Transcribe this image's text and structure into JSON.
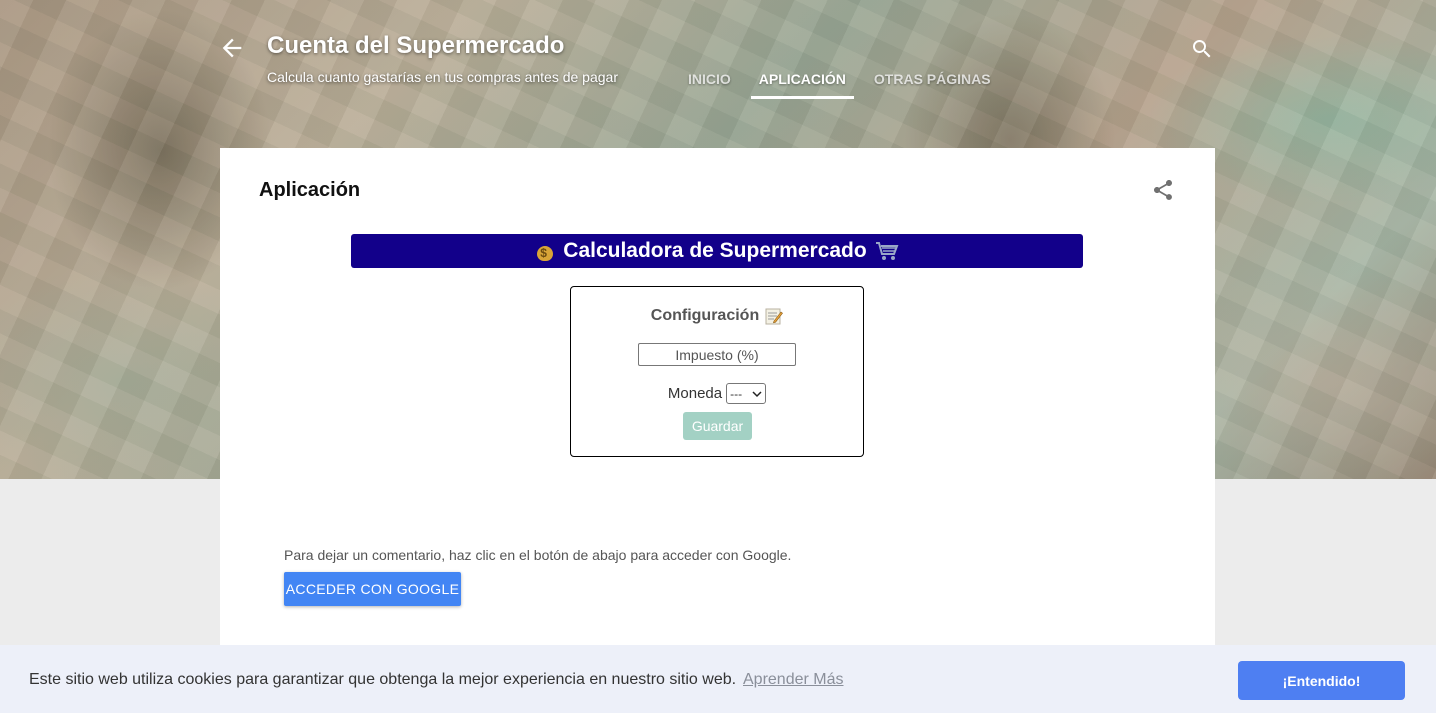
{
  "header": {
    "title": "Cuenta del Supermercado",
    "description": "Calcula cuanto gastarías en tus compras antes de pagar",
    "nav": [
      {
        "label": "INICIO",
        "active": false
      },
      {
        "label": "APLICACIÓN",
        "active": true
      },
      {
        "label": "OTRAS PÁGINAS",
        "active": false
      }
    ]
  },
  "post": {
    "title": "Aplicación"
  },
  "calculator": {
    "banner_title": "Calculadora de Supermercado",
    "config_title": "Configuración",
    "tax_placeholder": "Impuesto (%)",
    "currency_label": "Moneda",
    "currency_selected": "---",
    "save_label": "Guardar"
  },
  "comments": {
    "note": "Para dejar un comentario, haz clic en el botón de abajo para acceder con Google.",
    "google_button": "ACCEDER CON GOOGLE"
  },
  "cookie": {
    "text": "Este sitio web utiliza cookies para garantizar que obtenga la mejor experiencia en nuestro sitio web.",
    "link": "Aprender Más",
    "button": "¡Entendido!"
  },
  "colors": {
    "banner_bg": "#12008a",
    "save_button_bg": "#a3d1c4",
    "google_button_bg": "#4285f4",
    "cookie_button_bg": "#4e7ff2"
  },
  "icons": [
    "back-arrow-icon",
    "search-icon",
    "share-icon",
    "money-bag-icon",
    "shopping-cart-icon",
    "memo-icon",
    "chevron-down-icon"
  ]
}
